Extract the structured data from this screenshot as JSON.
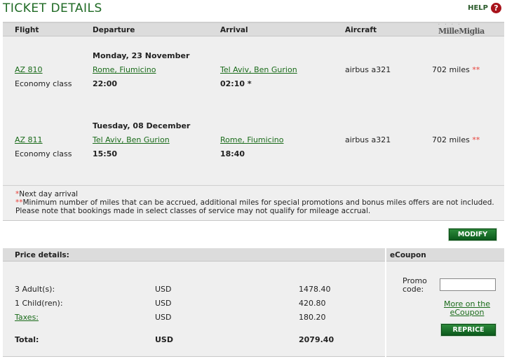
{
  "page": {
    "title": "TICKET DETAILS",
    "help_label": "HELP",
    "help_icon": "?"
  },
  "columns": {
    "flight": "Flight",
    "departure": "Departure",
    "arrival": "Arrival",
    "aircraft": "Aircraft",
    "millemiglia_logo": "MilleMiglia"
  },
  "flights": [
    {
      "date": "Monday, 23 November",
      "flight_no": "AZ 810",
      "class": "Economy class",
      "dep_city": "Rome, Fiumicino",
      "dep_time": "22:00",
      "arr_city": "Tel Aviv, Ben Gurion",
      "arr_time": "02:10 *",
      "aircraft": "airbus a321",
      "miles": "702 miles",
      "miles_mark": "**"
    },
    {
      "date": "Tuesday, 08 December",
      "flight_no": "AZ 811",
      "class": "Economy class",
      "dep_city": "Tel Aviv, Ben Gurion",
      "dep_time": "15:50",
      "arr_city": "Rome, Fiumicino",
      "arr_time": "18:40",
      "aircraft": "airbus a321",
      "miles": "702 miles",
      "miles_mark": "**"
    }
  ],
  "notes": {
    "next_day_mark": "*",
    "next_day": "Next day arrival",
    "miles_mark": "**",
    "miles_note": "Minimum number of miles that can be accrued, additional miles for special promotions and bonus miles offers are not included. Please note that bookings made in select classes of service may not qualify for mileage accrual."
  },
  "modify_label": "MODIFY",
  "price": {
    "header": "Price details:",
    "rows": [
      {
        "label": "3 Adult(s):",
        "currency": "USD",
        "amount": "1478.40"
      },
      {
        "label": "1 Child(ren):",
        "currency": "USD",
        "amount": "420.80"
      },
      {
        "label": "Taxes:",
        "currency": "USD",
        "amount": "180.20"
      }
    ],
    "total": {
      "label": "Total:",
      "currency": "USD",
      "amount": "2079.40"
    }
  },
  "ecoupon": {
    "header": "eCoupon",
    "promo_label_1": "Promo",
    "promo_label_2": "code:",
    "promo_value": "",
    "more_link_1": "More on the",
    "more_link_2": "eCoupon",
    "reprice_label": "REPRICE"
  },
  "colors": {
    "title_green": "#1f6a24",
    "button_green": "#0c5a1c",
    "star_red": "#e8413a",
    "help_red": "#a8131b"
  }
}
